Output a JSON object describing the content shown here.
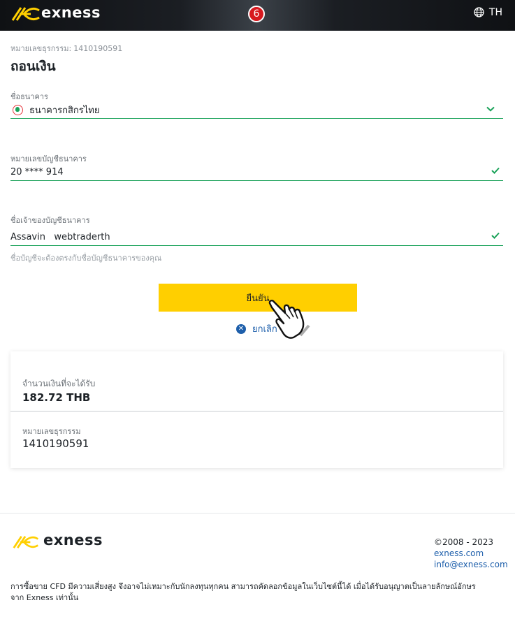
{
  "header": {
    "logo_text": "exness",
    "step_number": "6",
    "language": "TH",
    "brand_color": "#ffcf00"
  },
  "main": {
    "transaction_caption": "หมายเลขธุรกรรม:",
    "transaction_caption_id": "1410190591",
    "title": "ถอนเงิน",
    "fields": {
      "bank_name": {
        "label": "ชื่อธนาคาร",
        "value": "ธนาคารกสิกรไทย",
        "icon": "chevron-down-icon"
      },
      "account_number": {
        "label": "หมายเลขบัญชีธนาคาร",
        "value": "20 **** 914",
        "icon": "check-icon"
      },
      "account_holder": {
        "label": "ชื่อเจ้าของบัญชีธนาคาร",
        "value": "Assavin   webtraderth",
        "icon": "check-icon"
      }
    },
    "hint": "ชื่อบัญชีจะต้องตรงกับชื่อบัญชีธนาคารของคุณ",
    "confirm_label": "ยืนยัน",
    "cancel_label": "ยกเลิก",
    "accent_green": "#1aa259",
    "link_blue": "#1e5fab"
  },
  "summary": {
    "amount_label": "จำนวนเงินที่จะได้รับ",
    "amount_value": "182.72 THB",
    "transaction_label": "หมายเลขธุรกรรม",
    "transaction_value": "1410190591"
  },
  "footer": {
    "logo_text": "exness",
    "copyright": "©2008 - 2023",
    "site_link": "exness.com",
    "email_link": "info@exness.com",
    "disclaimer_line1": "การซื้อขาย CFD มีความเสี่ยงสูง จึงอาจไม่เหมาะกับนักลงทุนทุกคน สามารถคัดลอกข้อมูลในเว็บไซต์นี้ได้ เมื่อได้รับอนุญาตเป็นลายลักษณ์อักษร",
    "disclaimer_line2": "จาก Exness เท่านั้น"
  }
}
